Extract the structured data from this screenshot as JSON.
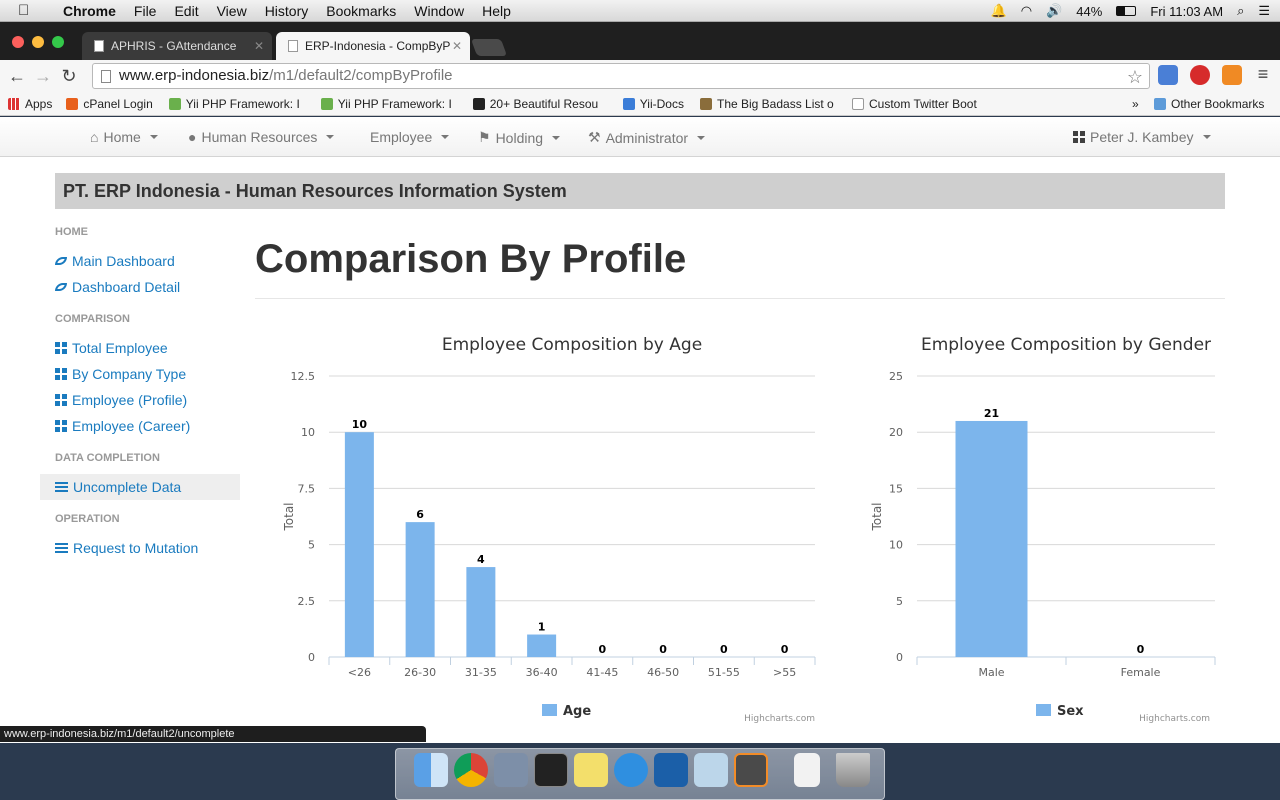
{
  "macbar": {
    "app": "Chrome",
    "menus": [
      "File",
      "Edit",
      "View",
      "History",
      "Bookmarks",
      "Window",
      "Help"
    ],
    "battery": "44%",
    "clock": "Fri 11:03 AM"
  },
  "tabs": [
    {
      "title": "APHRIS - GAttendance"
    },
    {
      "title": "ERP-Indonesia - CompByP"
    }
  ],
  "url": {
    "host": "www.erp-indonesia.biz",
    "path": "/m1/default2/compByProfile"
  },
  "bookmarks": [
    "Apps",
    "cPanel Login",
    "Yii PHP Framework: I",
    "Yii PHP Framework: I",
    "20+ Beautiful Resou",
    "Yii-Docs",
    "The Big Badass List o",
    "Custom Twitter Boot"
  ],
  "bookmarks_more": "»",
  "bookmarks_other": "Other Bookmarks",
  "nav": {
    "items": [
      "Home",
      "Human Resources",
      "Employee",
      "Holding",
      "Administrator"
    ],
    "user": "Peter J. Kambey"
  },
  "header_band": "PT. ERP Indonesia - Human Resources Information System",
  "sidebar": {
    "home_header": "HOME",
    "home_items": [
      "Main Dashboard",
      "Dashboard Detail"
    ],
    "comparison_header": "COMPARISON",
    "comparison_items": [
      "Total Employee",
      "By Company Type",
      "Employee (Profile)",
      "Employee (Career)"
    ],
    "completion_header": "DATA COMPLETION",
    "completion_items": [
      "Uncomplete Data"
    ],
    "operation_header": "OPERATION",
    "operation_items": [
      "Request to Mutation"
    ]
  },
  "page_title": "Comparison By Profile",
  "credits": "Highcharts.com",
  "status_url": "www.erp-indonesia.biz/m1/default2/uncomplete",
  "colors": {
    "bar": "#7cb5ec",
    "link": "#1a7bbf",
    "band": "#cfcfcf"
  },
  "chart_data": [
    {
      "type": "bar",
      "title": "Employee Composition by Age",
      "categories": [
        "<26",
        "26-30",
        "31-35",
        "36-40",
        "41-45",
        "46-50",
        "51-55",
        ">55"
      ],
      "series": [
        {
          "name": "Age",
          "values": [
            10,
            6,
            4,
            1,
            0,
            0,
            0,
            0
          ]
        }
      ],
      "ylabel": "Total",
      "yticks": [
        "0",
        "2.5",
        "5",
        "7.5",
        "10",
        "12.5"
      ],
      "ylim": [
        0,
        12.5
      ],
      "legend": "bottom-center"
    },
    {
      "type": "bar",
      "title": "Employee Composition by Gender",
      "categories": [
        "Male",
        "Female"
      ],
      "series": [
        {
          "name": "Sex",
          "values": [
            21,
            0
          ]
        }
      ],
      "ylabel": "Total",
      "yticks": [
        "0",
        "5",
        "10",
        "15",
        "20",
        "25"
      ],
      "ylim": [
        0,
        25
      ],
      "legend": "bottom-center"
    }
  ]
}
